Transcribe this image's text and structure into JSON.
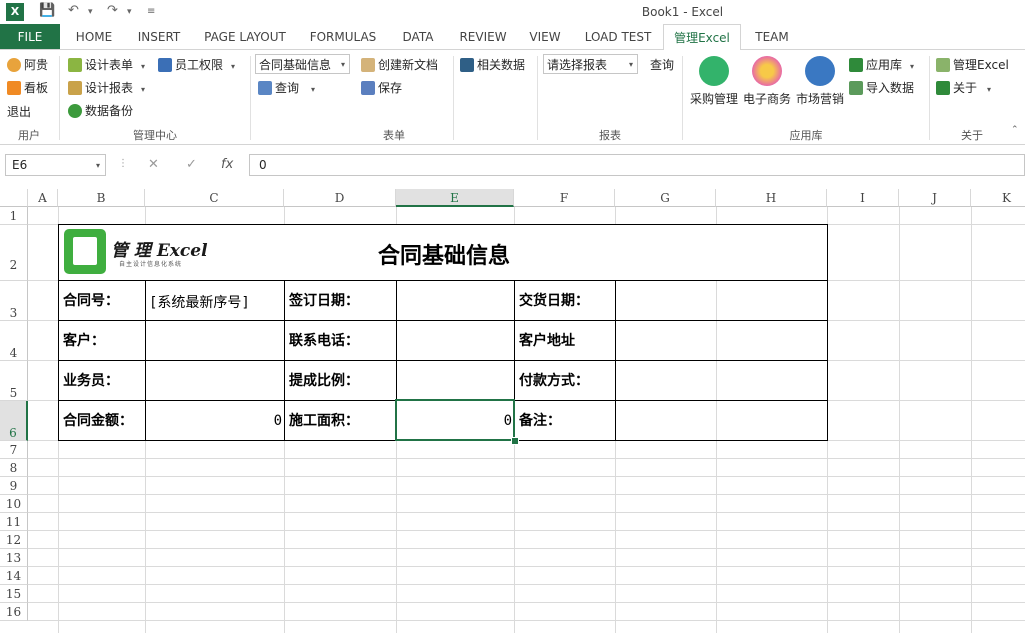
{
  "window": {
    "title": "Book1 - Excel",
    "app_icon": "X"
  },
  "tabs": [
    "FILE",
    "HOME",
    "INSERT",
    "PAGE LAYOUT",
    "FORMULAS",
    "DATA",
    "REVIEW",
    "VIEW",
    "LOAD TEST",
    "管理Excel",
    "TEAM"
  ],
  "active_tab": "管理Excel",
  "ribbon": {
    "user": {
      "items": [
        "阿贵",
        "看板",
        "退出"
      ],
      "group": "用户"
    },
    "mgmt": {
      "items": [
        "设计表单",
        "设计报表",
        "数据备份",
        "员工权限"
      ],
      "group": "管理中心"
    },
    "form": {
      "select": "合同基础信息",
      "query": "查询",
      "new_doc": "创建新文档",
      "save": "保存",
      "related": "相关数据",
      "group": "表单"
    },
    "report": {
      "select": "请选择报表",
      "query": "查询",
      "group": "报表"
    },
    "apps": {
      "purchase": "采购管理",
      "ecommerce": "电子商务",
      "marketing": "市场营销",
      "app_lib": "应用库",
      "import": "导入数据",
      "group": "应用库"
    },
    "about": {
      "manage": "管理Excel",
      "about": "关于",
      "group": "关于"
    }
  },
  "formula_bar": {
    "name_box": "E6",
    "value": "0",
    "fx": "fx"
  },
  "columns": [
    "A",
    "B",
    "C",
    "D",
    "E",
    "F",
    "G",
    "H",
    "I",
    "J",
    "K"
  ],
  "rows": [
    "1",
    "2",
    "3",
    "4",
    "5",
    "6",
    "7",
    "8",
    "9",
    "10",
    "11",
    "12",
    "13",
    "14",
    "15",
    "16"
  ],
  "selected": {
    "col": "E",
    "row": "6"
  },
  "sheet": {
    "logo_text": "管 理 Excel",
    "logo_sub": "自主设计信息化系统",
    "title": "合同基础信息",
    "labels": {
      "contract_no": "合同号：",
      "serial": "[系统最新序号]",
      "sign_date": "签订日期：",
      "delivery_date": "交货日期：",
      "customer": "客户：",
      "phone": "联系电话：",
      "address": "客户地址",
      "salesman": "业务员：",
      "commission": "提成比例：",
      "payment": "付款方式：",
      "amount": "合同金额：",
      "amount_value": "0",
      "area": "施工面积：",
      "area_value": "0",
      "remark": "备注："
    }
  },
  "colors": {
    "excel_green": "#217346",
    "header_select": "#e1e1e1"
  }
}
